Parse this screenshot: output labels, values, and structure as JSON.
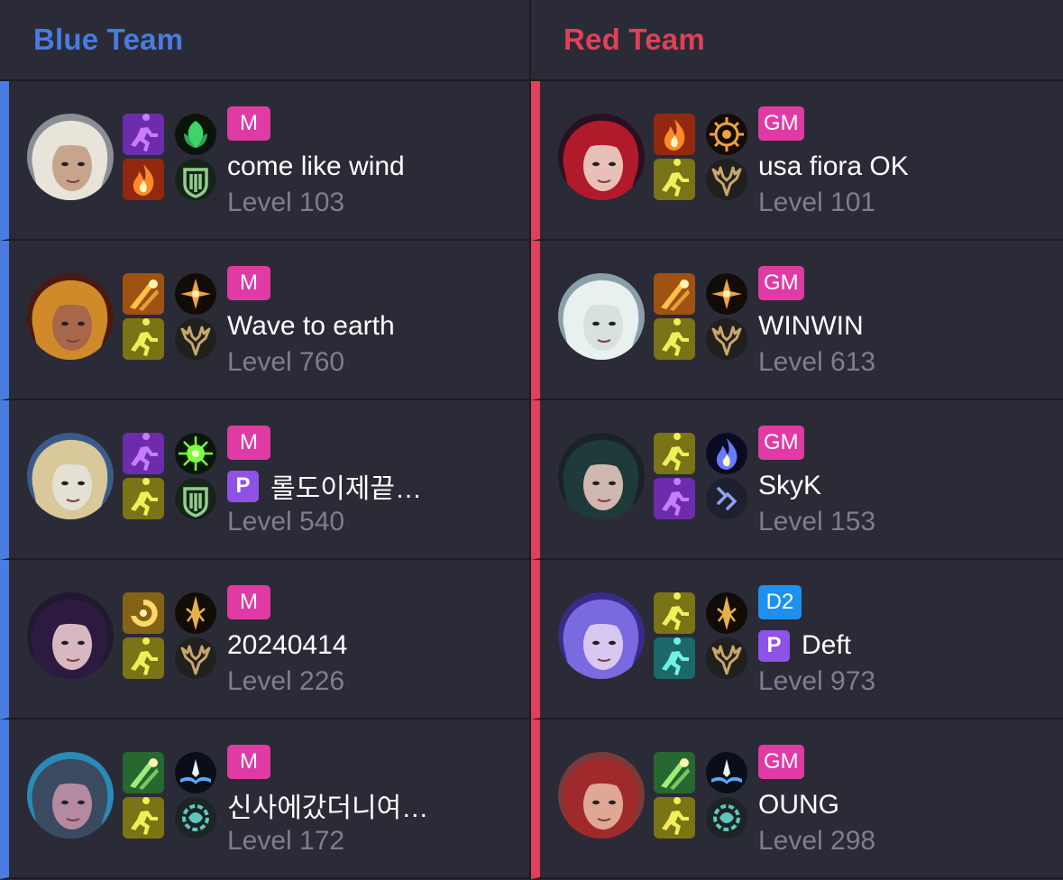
{
  "colors": {
    "background": "#2a2b36",
    "divider": "#1b1c23",
    "blue_team": "#4a7be0",
    "red_team": "#e0405a",
    "tier_master": "#e03aa4",
    "tier_grandmaster": "#e03aa4",
    "tier_diamond": "#1e90f0",
    "pro_badge": "#8e52e6",
    "name_text": "#ffffff",
    "level_text": "#7e7e8e"
  },
  "teams": {
    "blue": {
      "title": "Blue Team",
      "color": "#4a7be0",
      "players": [
        {
          "avatar": "champion-portrait-white-hair",
          "icons": [
            "spell-purple-runner",
            "rune-green-leaf",
            "spell-red-fire",
            "rune-green-shield"
          ],
          "tier": "M",
          "tier_color": "#e03aa4",
          "pro": "",
          "name": "come like wind",
          "level": "Level 103"
        },
        {
          "avatar": "champion-portrait-golden-helmet",
          "icons": [
            "spell-orange-strike",
            "rune-gold-cross",
            "spell-yellow-flash",
            "rune-gold-antlers"
          ],
          "tier": "M",
          "tier_color": "#e03aa4",
          "pro": "",
          "name": "Wave to earth",
          "level": "Level 760"
        },
        {
          "avatar": "champion-portrait-golden-armor",
          "icons": [
            "spell-purple-runner",
            "rune-green-burst",
            "spell-yellow-flash",
            "rune-green-shield"
          ],
          "tier": "M",
          "tier_color": "#e03aa4",
          "pro": "P",
          "name": "롤도이제끝…",
          "level": "Level 540"
        },
        {
          "avatar": "champion-portrait-dark-hair",
          "icons": [
            "spell-gold-swirl",
            "rune-gold-blade",
            "spell-yellow-flash",
            "rune-gold-antlers"
          ],
          "tier": "M",
          "tier_color": "#e03aa4",
          "pro": "",
          "name": "20240414",
          "level": "Level 226"
        },
        {
          "avatar": "champion-portrait-mustache",
          "icons": [
            "spell-green-teleport",
            "rune-blue-book",
            "spell-yellow-flash",
            "rune-teal-gear"
          ],
          "tier": "M",
          "tier_color": "#e03aa4",
          "pro": "",
          "name": "신사에갔더니여…",
          "level": "Level 172"
        }
      ]
    },
    "red": {
      "title": "Red Team",
      "color": "#e0405a",
      "players": [
        {
          "avatar": "champion-portrait-red-hair",
          "icons": [
            "spell-red-fire",
            "rune-gold-sun",
            "spell-yellow-flash",
            "rune-gold-antlers"
          ],
          "tier": "GM",
          "tier_color": "#e03aa4",
          "pro": "",
          "name": "usa fiora OK",
          "level": "Level 101"
        },
        {
          "avatar": "champion-portrait-pale-face",
          "icons": [
            "spell-orange-strike",
            "rune-gold-cross",
            "spell-yellow-flash",
            "rune-gold-antlers"
          ],
          "tier": "GM",
          "tier_color": "#e03aa4",
          "pro": "",
          "name": "WINWIN",
          "level": "Level 613"
        },
        {
          "avatar": "champion-portrait-dark-teal-hair",
          "icons": [
            "spell-yellow-flash",
            "rune-blue-flame",
            "spell-purple-runner",
            "rune-blue-arrows"
          ],
          "tier": "GM",
          "tier_color": "#e03aa4",
          "pro": "",
          "name": "SkyK",
          "level": "Level 153"
        },
        {
          "avatar": "champion-portrait-violet-spirit",
          "icons": [
            "spell-yellow-flash",
            "rune-gold-blade",
            "spell-teal-runner",
            "rune-gold-antlers"
          ],
          "tier": "D2",
          "tier_color": "#1e90f0",
          "pro": "P",
          "name": "Deft",
          "level": "Level 973"
        },
        {
          "avatar": "champion-portrait-red-haired-man",
          "icons": [
            "spell-green-teleport",
            "rune-blue-book",
            "spell-yellow-flash",
            "rune-teal-gear"
          ],
          "tier": "GM",
          "tier_color": "#e03aa4",
          "pro": "",
          "name": "OUNG",
          "level": "Level 298"
        }
      ]
    }
  }
}
